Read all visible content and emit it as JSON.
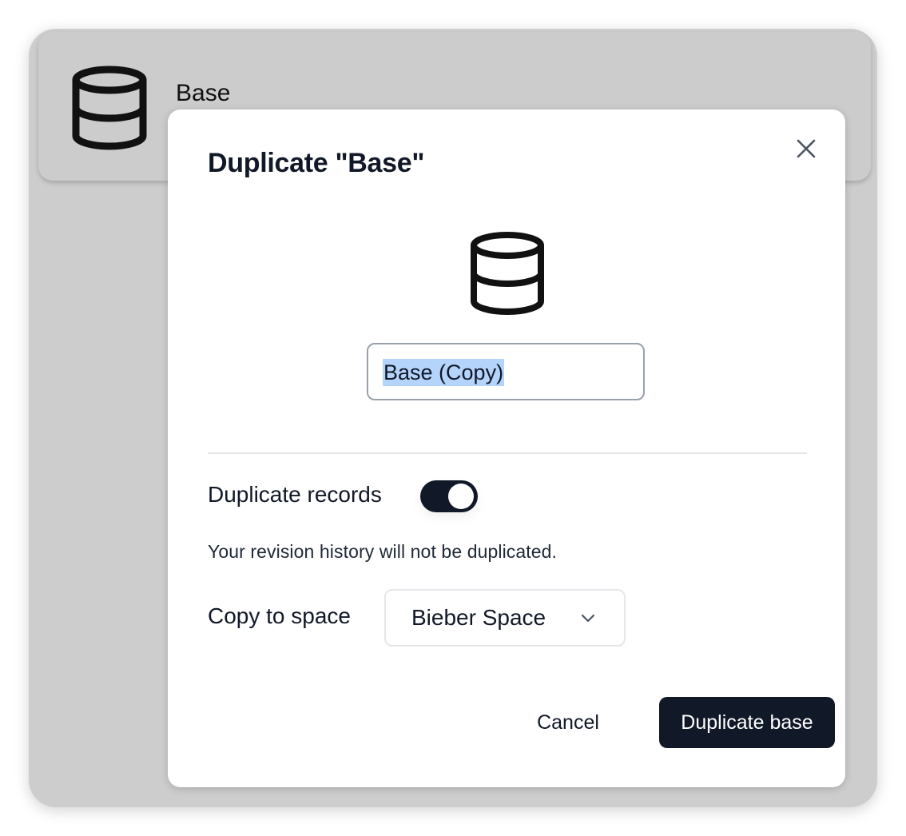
{
  "background_card": {
    "title": "Base",
    "icon": "database-icon"
  },
  "dialog": {
    "title": "Duplicate \"Base\"",
    "close_icon": "close-icon",
    "center_icon": "database-icon",
    "name_input": {
      "value": "Base (Copy)",
      "selected": true
    },
    "duplicate_records": {
      "label": "Duplicate records",
      "enabled": true
    },
    "hint": "Your revision history will not be duplicated.",
    "copy_to_space": {
      "label": "Copy to space",
      "selected": "Bieber Space",
      "icon": "chevron-down-icon"
    },
    "buttons": {
      "cancel": "Cancel",
      "confirm": "Duplicate base"
    }
  },
  "colors": {
    "overlay": "#cdcdcd",
    "primary": "#111827",
    "selection": "#b4d4fb",
    "input_border": "#9aa1ab"
  }
}
